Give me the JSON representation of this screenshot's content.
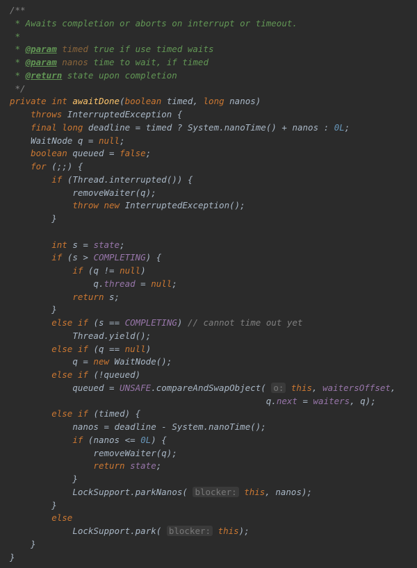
{
  "doc": {
    "open": "/**",
    "l1": " * Awaits completion or aborts on interrupt or timeout.",
    "l2": " *",
    "l3_pre": " * ",
    "l3_tag": "@param",
    "l3_name": " timed",
    "l3_rest": " true if use timed waits",
    "l4_pre": " * ",
    "l4_tag": "@param",
    "l4_name": " nanos",
    "l4_rest": " time to wait, if timed",
    "l5_pre": " * ",
    "l5_tag": "@return",
    "l5_rest": " state upon completion",
    "close": " */"
  },
  "kw": {
    "private": "private",
    "int": "int",
    "boolean": "boolean",
    "long": "long",
    "throws": "throws",
    "final": "final",
    "null": "null",
    "false": "false",
    "for": "for",
    "if": "if",
    "throw": "throw",
    "new": "new",
    "return": "return",
    "else": "else",
    "this": "this"
  },
  "id": {
    "awaitDone": "awaitDone",
    "timed": "timed",
    "nanos": "nanos",
    "InterruptedException": "InterruptedException",
    "deadline": "deadline",
    "System": "System",
    "nanoTime": "nanoTime",
    "WaitNode": "WaitNode",
    "q": "q",
    "queued": "queued",
    "Thread": "Thread",
    "interrupted": "interrupted",
    "removeWaiter": "removeWaiter",
    "s": "s",
    "state": "state",
    "COMPLETING": "COMPLETING",
    "thread": "thread",
    "yield": "yield",
    "UNSAFE": "UNSAFE",
    "compareAndSwapObject": "compareAndSwapObject",
    "waitersOffset": "waitersOffset",
    "next": "next",
    "waiters": "waiters",
    "LockSupport": "LockSupport",
    "parkNanos": "parkNanos",
    "park": "park"
  },
  "num": {
    "zeroL": "0L",
    "plus": " + ",
    "cond": " ? ",
    "colon": " : "
  },
  "hint": {
    "o": "o:",
    "blocker": "blocker:"
  },
  "cmt": {
    "cannot": "// cannot time out yet"
  },
  "p": {
    "open_paren": "(",
    "close_paren": ")",
    "open_brace": " {",
    "close_brace": "}",
    "semi": ";",
    "comma": ", ",
    "eq": " = ",
    "gt": " > ",
    "eqeq": " == ",
    "neq": " != ",
    "not": "!",
    "le": " <= ",
    "minus": " - ",
    "dot": ".",
    "empty_for": " (;;) {",
    "paren_empty": "()",
    "space": " "
  }
}
